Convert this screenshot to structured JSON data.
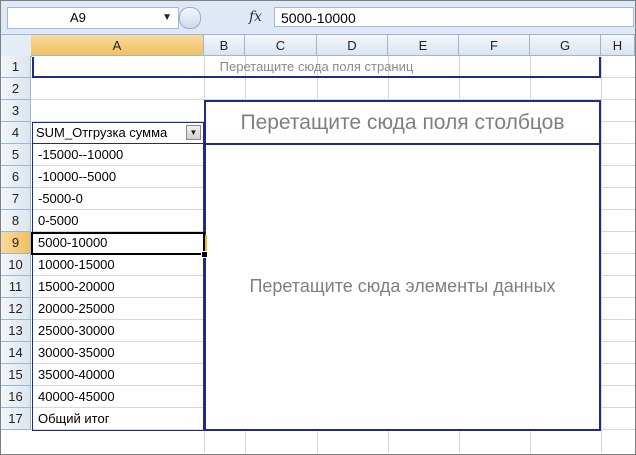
{
  "name_box": {
    "value": "A9"
  },
  "formula_bar": {
    "fx_label": "fx",
    "content": "5000-10000"
  },
  "columns": [
    "A",
    "B",
    "C",
    "D",
    "E",
    "F",
    "G",
    "H"
  ],
  "rows": [
    "1",
    "2",
    "3",
    "4",
    "5",
    "6",
    "7",
    "8",
    "9",
    "10",
    "11",
    "12",
    "13",
    "14",
    "15",
    "16",
    "17"
  ],
  "selected": {
    "column": "A",
    "row": "9"
  },
  "pivot": {
    "page_drop_hint": "Перетащите сюда поля страниц",
    "column_drop_hint": "Перетащите сюда поля столбцов",
    "data_drop_hint": "Перетащите сюда элементы данных",
    "row_field": "SUM_Отгрузка сумма",
    "row_items": [
      "-15000--10000",
      "-10000--5000",
      "-5000-0",
      "0-5000",
      "5000-10000",
      "10000-15000",
      "15000-20000",
      "20000-25000",
      "25000-30000",
      "30000-35000",
      "35000-40000",
      "40000-45000",
      "Общий итог"
    ]
  },
  "colors": {
    "pivot_border": "#1f2a8a",
    "header_selected": "#f1c15f",
    "header_bg": "#dbe4f0"
  }
}
